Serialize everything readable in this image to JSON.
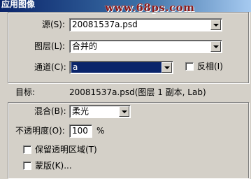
{
  "window": {
    "title": "应用图像",
    "watermark": "www.68ps.com"
  },
  "source_group": {
    "source_label": "源(S):",
    "source_value": "20081537a.psd",
    "layer_label": "图层(L):",
    "layer_value": "合并的",
    "channel_label": "通道(C):",
    "channel_value": "a",
    "invert_label": "反相(I)",
    "invert_checked": false
  },
  "target": {
    "label": "目标:",
    "value": "20081537a.psd(图层 1 副本, Lab)"
  },
  "blend_group": {
    "blend_label": "混合(B):",
    "blend_value": "柔光",
    "opacity_label": "不透明度(O):",
    "opacity_value": "100",
    "opacity_unit": "%",
    "preserve_label": "保留透明区域(T)",
    "preserve_checked": false,
    "mask_label": "蒙版(K)...",
    "mask_checked": false
  }
}
